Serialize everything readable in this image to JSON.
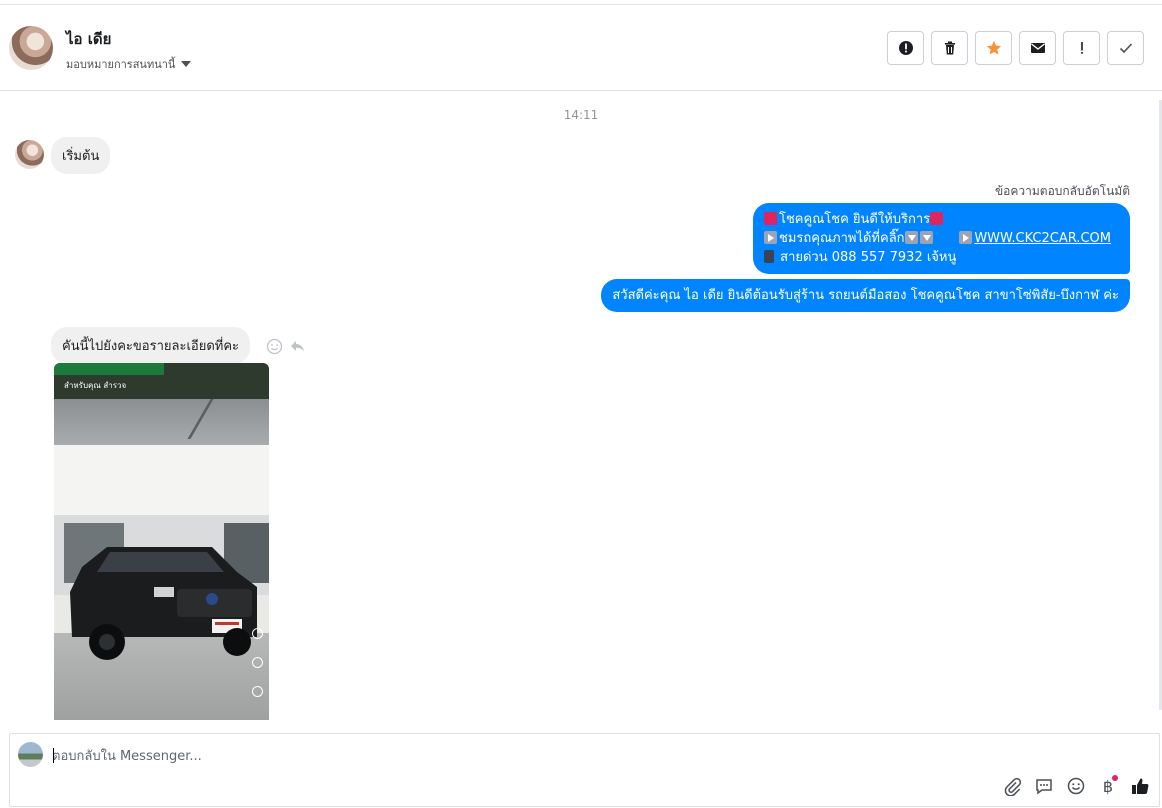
{
  "header": {
    "name": "ไอ เดีย",
    "assign_label": "มอบหมายการสนทนานี้",
    "actions": [
      "spam-button",
      "delete-button",
      "star-button",
      "unread-button",
      "follow-up-button",
      "done-button"
    ]
  },
  "chat": {
    "timestamp": "14:11",
    "start_message": "เริ่มต้น",
    "auto_reply_label": "ข้อความตอบกลับอัตโนมัติ",
    "auto_reply": {
      "line1": "โชคคูณโชค ยินดีให้บริการ",
      "line2": "ชมรถคุณภาพได้ที่คลิ๊ก",
      "link": "WWW.CKC2CAR.COM",
      "line3": "สายด่วน 088 557 7932 เจ้หนู"
    },
    "greeting": "สวัสดีค่ะคุณ ไอ เดีย ยินดีต้อนรับสู่ร้าน รถยนต์มือสอง โชคคูณโชค สาขาโซ่พิสัย-บึงกาฬ ค่ะ",
    "customer_question": "คันนี้ไปยังคะขอรายละเอียดที่คะ",
    "photo_caption": "สำหรับคุณ   สำรวจ"
  },
  "composer": {
    "placeholder": "ตอบกลับใน Messenger...",
    "currency_symbol": "฿"
  },
  "colors": {
    "accent": "#0084ff",
    "star": "#f7923b"
  }
}
